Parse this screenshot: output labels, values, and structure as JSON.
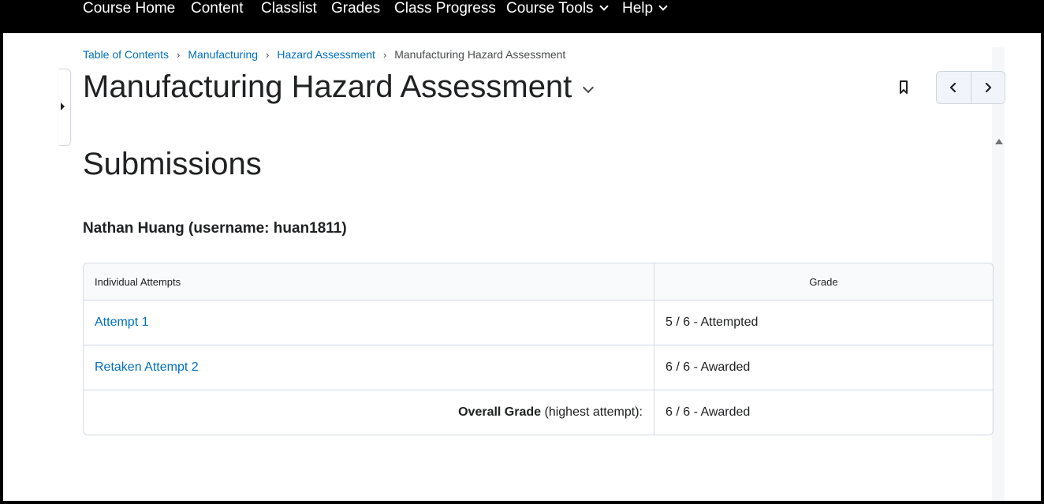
{
  "topnav": {
    "items": [
      {
        "label": "Course Home",
        "has_menu": false
      },
      {
        "label": "Content",
        "has_menu": false
      },
      {
        "label": "Classlist",
        "has_menu": false
      },
      {
        "label": "Grades",
        "has_menu": false
      },
      {
        "label": "Class Progress",
        "has_menu": false
      },
      {
        "label": "Course Tools",
        "has_menu": true
      },
      {
        "label": "Help",
        "has_menu": true
      }
    ]
  },
  "breadcrumb": {
    "items": [
      "Table of Contents",
      "Manufacturing",
      "Hazard Assessment"
    ],
    "separator": "›",
    "current": "Manufacturing Hazard Assessment"
  },
  "page": {
    "title": "Manufacturing Hazard Assessment",
    "section_title": "Submissions",
    "user_heading": "Nathan Huang (username: huan1811)"
  },
  "table": {
    "headers": [
      "Individual Attempts",
      "Grade"
    ],
    "rows": [
      {
        "attempt": "Attempt 1",
        "grade": "5 / 6 - Attempted"
      },
      {
        "attempt": "Retaken Attempt 2",
        "grade": "6 / 6 - Awarded"
      }
    ],
    "overall_label_bold": "Overall Grade",
    "overall_label_rest": " (highest attempt):",
    "overall_grade": "6 / 6 - Awarded"
  },
  "icons": {
    "bookmark": "bookmark-icon",
    "prev": "chevron-left-icon",
    "next": "chevron-right-icon",
    "title_menu": "chevron-down-icon",
    "side_toggle": "caret-right-icon"
  },
  "colors": {
    "link": "#006fbf",
    "text": "#202122",
    "nav_bg": "#000000",
    "border": "#d3d9e3"
  }
}
